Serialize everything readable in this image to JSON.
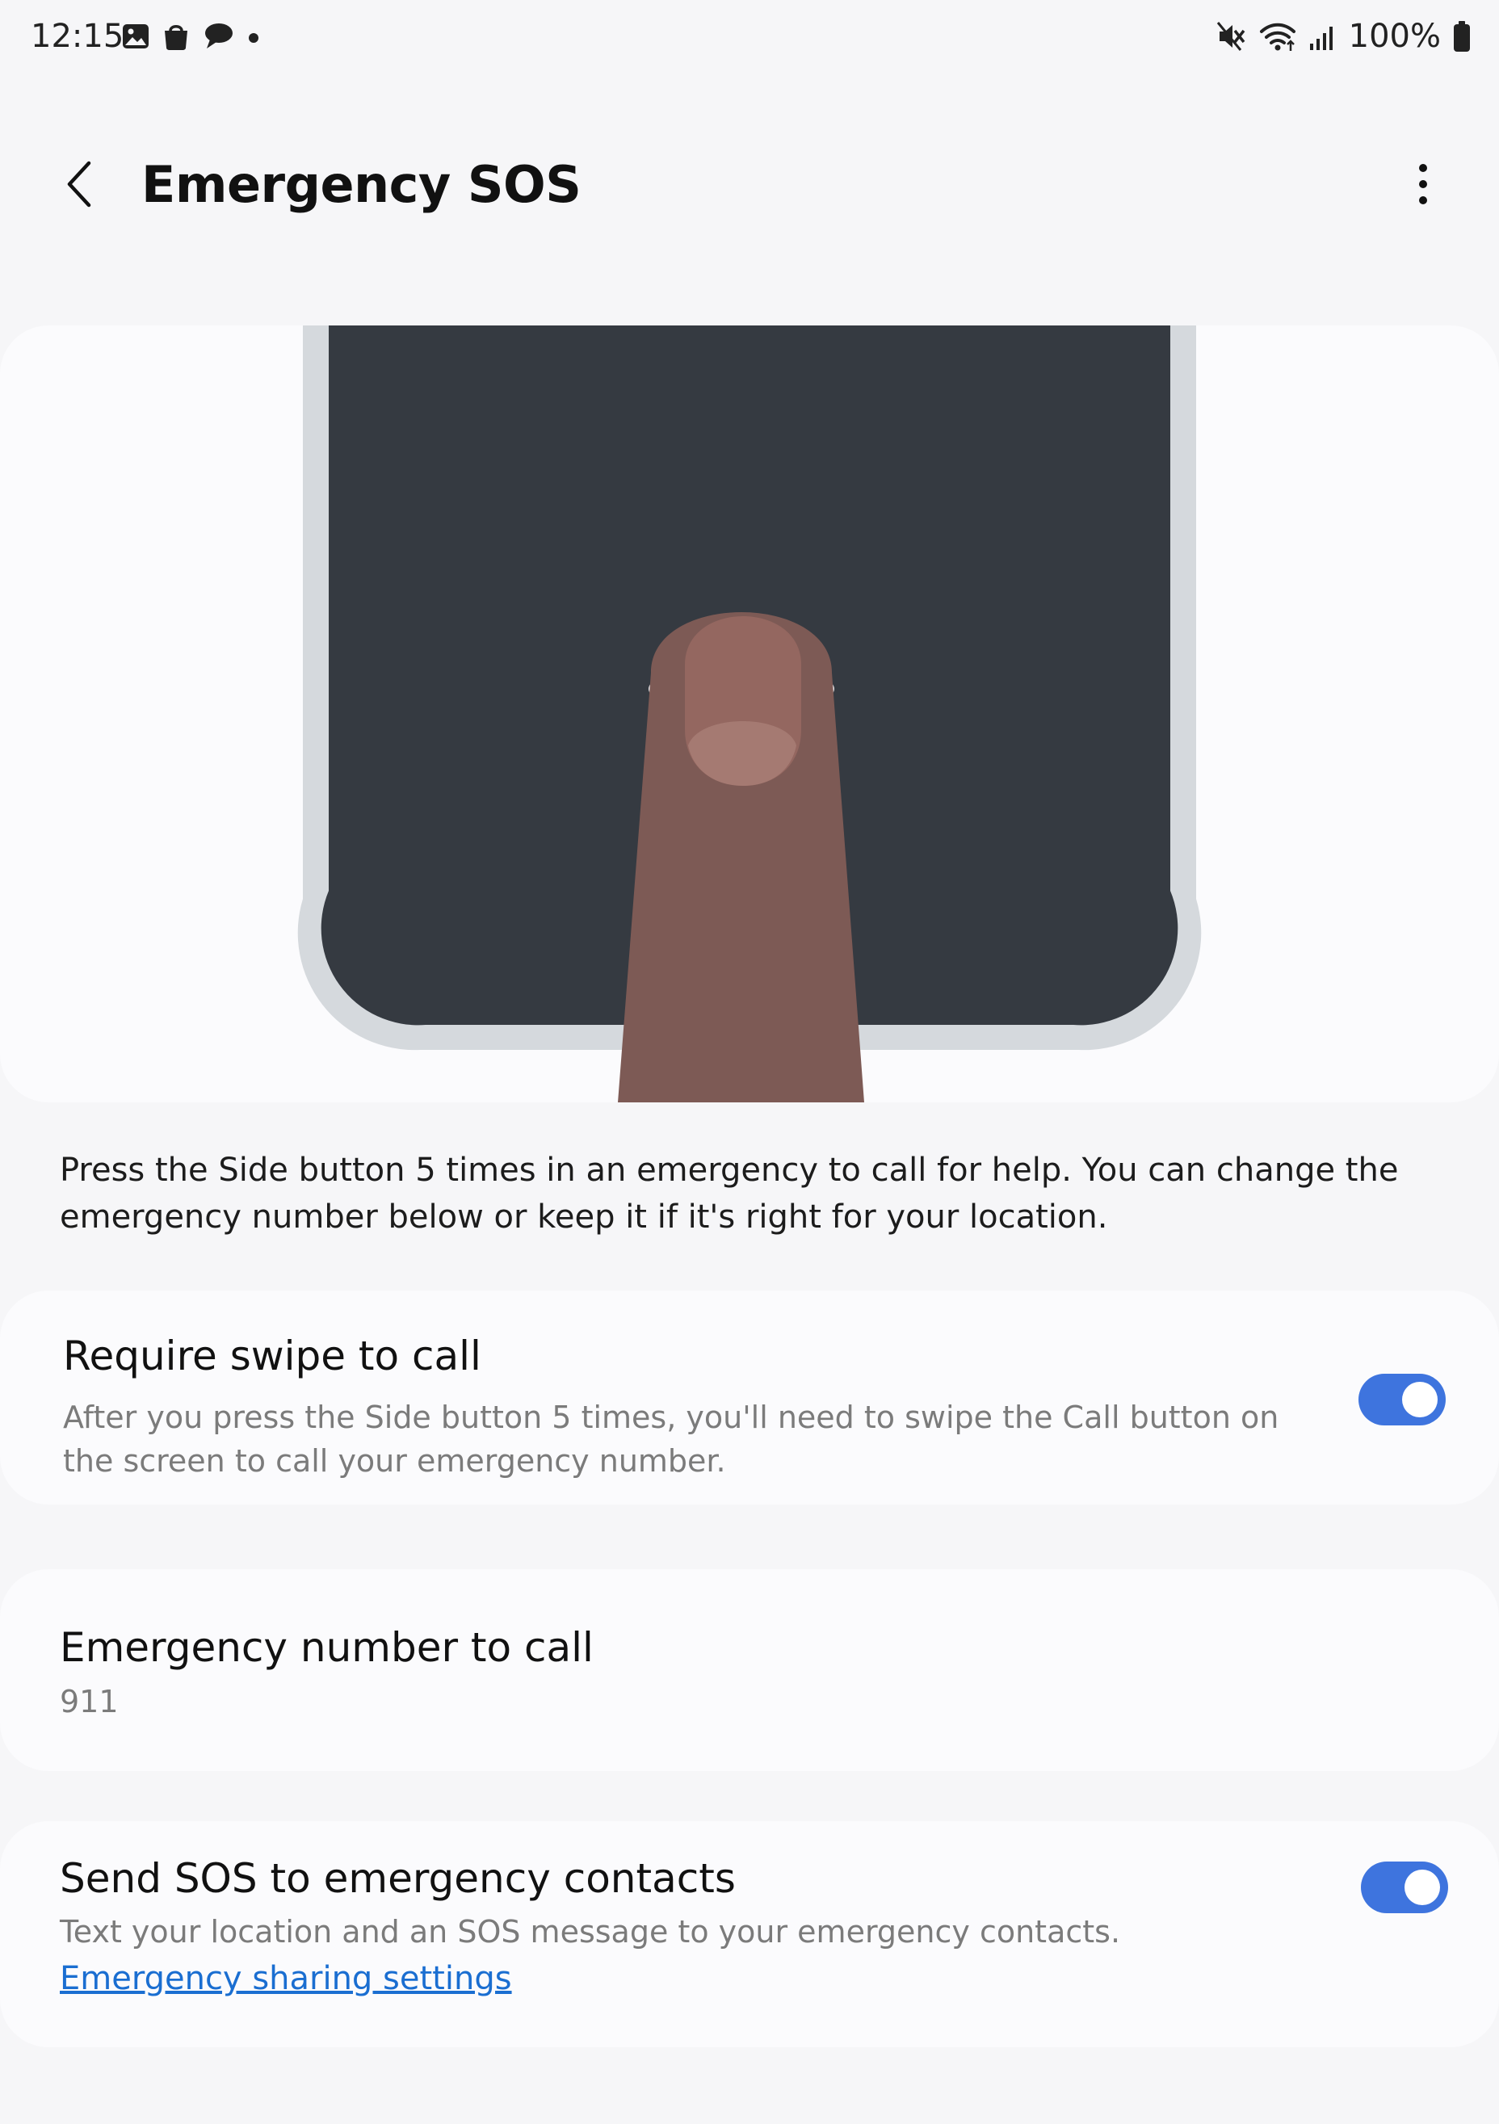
{
  "status_bar": {
    "time": "12:15",
    "left_icons": [
      "gallery-icon",
      "shopping-bag-icon",
      "chat-bubble-icon",
      "dot-icon"
    ],
    "right_icons": [
      "mute-icon",
      "wifi-icon",
      "signal-icon"
    ],
    "battery_text": "100%"
  },
  "header": {
    "title": "Emergency SOS",
    "back_icon": "back-arrow-icon",
    "more_icon": "more-options-icon"
  },
  "illustration": {
    "description_icon": "finger-pressing-phone-illustration"
  },
  "description": "Press the Side button 5 times in an emergency to call for help. You can change the emergency number below or keep it if it's right for your location.",
  "require_swipe": {
    "title": "Require swipe to call",
    "subtitle": "After you press the Side button 5 times, you'll need to swipe the Call button on the screen to call your emergency number.",
    "enabled": true
  },
  "emergency_number": {
    "title": "Emergency number to call",
    "value": "911"
  },
  "send_sos": {
    "title": "Send SOS to emergency contacts",
    "subtitle": "Text your location and an SOS message to your emergency contacts.",
    "link": "Emergency sharing settings",
    "enabled": true
  },
  "colors": {
    "accent": "#3e74de",
    "link": "#1a6ed1",
    "background": "#f6f6f8",
    "card": "#fbfbfd",
    "phone_screen": "#353a41",
    "phone_frame": "#d5d9dd",
    "finger": "#7d5a55"
  }
}
